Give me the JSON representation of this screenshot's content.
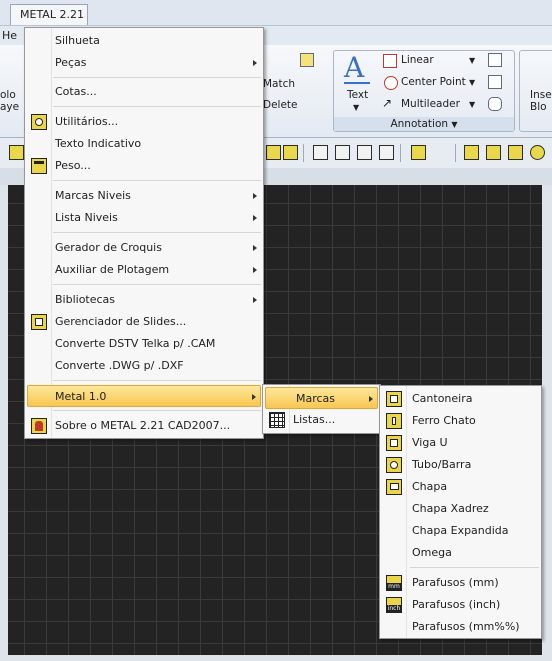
{
  "window": {
    "title_tab": "METAL 2.21",
    "menu_fragment": "He"
  },
  "ribbon": {
    "left_fragments": [
      "olo",
      "aye"
    ],
    "match": "Match",
    "delete": "Delete",
    "text": "Text",
    "linear": "Linear",
    "center_point": "Center Point",
    "multileader": "Multileader",
    "annotation": "Annotation",
    "ins_fragments": [
      "Inse",
      "Blo"
    ]
  },
  "main_menu": {
    "items": [
      {
        "label": "Silhueta"
      },
      {
        "label": "Peças",
        "submenu": true
      },
      {
        "label": "Cotas..."
      },
      {
        "label": "Utilitários...",
        "icon": "lightbulb-icon"
      },
      {
        "label": "Texto Indicativo"
      },
      {
        "label": "Peso...",
        "icon": "scale-icon"
      },
      {
        "label": "Marcas Niveis",
        "submenu": true
      },
      {
        "label": "Lista Niveis",
        "submenu": true
      },
      {
        "label": "Gerador de Croquis",
        "submenu": true
      },
      {
        "label": "Auxiliar de Plotagem",
        "submenu": true
      },
      {
        "label": "Bibliotecas",
        "submenu": true
      },
      {
        "label": "Gerenciador de Slides...",
        "icon": "slides-icon"
      },
      {
        "label": "Converte DSTV Telka p/ .CAM"
      },
      {
        "label": "Converte .DWG p/ .DXF"
      },
      {
        "label": "Metal 1.0",
        "submenu": true,
        "highlighted": true
      },
      {
        "label": "Sobre o METAL 2.21 CAD2007...",
        "icon": "about-icon"
      }
    ]
  },
  "sub_menu": {
    "items": [
      {
        "label": "Marcas",
        "submenu": true,
        "highlighted": true
      },
      {
        "label": "Listas...",
        "icon": "list-icon"
      }
    ]
  },
  "marcas_menu": {
    "items": [
      {
        "label": "Cantoneira",
        "icon": "angle-profile-icon"
      },
      {
        "label": "Ferro Chato",
        "icon": "flat-bar-icon"
      },
      {
        "label": "Viga U",
        "icon": "u-beam-icon"
      },
      {
        "label": "Tubo/Barra",
        "icon": "tube-bar-icon"
      },
      {
        "label": "Chapa",
        "icon": "plate-icon"
      },
      {
        "label": "Chapa Xadrez"
      },
      {
        "label": "Chapa Expandida"
      },
      {
        "label": "Omega"
      },
      {
        "label": "Parafusos (mm)",
        "icon": "bolt-mm-icon",
        "unit": "mm"
      },
      {
        "label": "Parafusos (inch)",
        "icon": "bolt-inch-icon",
        "unit": "inch"
      },
      {
        "label": "Parafusos (mm%%)"
      }
    ]
  },
  "colors": {
    "highlight": "#f8c652",
    "canvas": "#232323",
    "accent_blue": "#3a6fc4"
  }
}
